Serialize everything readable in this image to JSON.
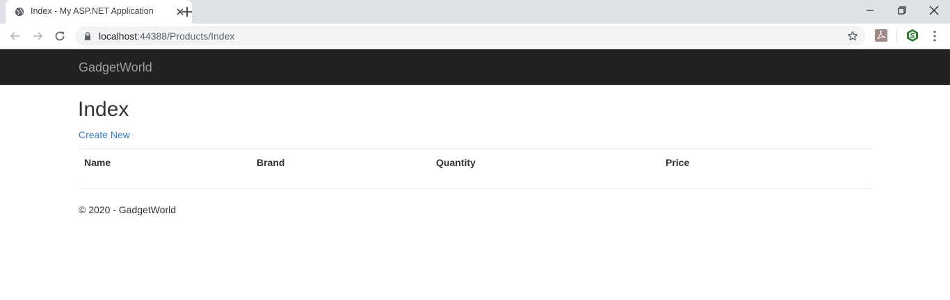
{
  "browser": {
    "tab": {
      "title": "Index - My ASP.NET Application"
    },
    "address_bar": {
      "host": "localhost",
      "port_path": ":44388/Products/Index"
    }
  },
  "navbar": {
    "brand": "GadgetWorld"
  },
  "main": {
    "title": "Index",
    "create_link": "Create New",
    "table": {
      "columns": [
        "Name",
        "Brand",
        "Quantity",
        "Price"
      ],
      "rows": []
    }
  },
  "footer": {
    "text": "© 2020 - GadgetWorld"
  },
  "colors": {
    "navbar_bg": "#222222",
    "brand_text": "#9d9d9d",
    "link": "#337ab7",
    "text": "#333333"
  }
}
